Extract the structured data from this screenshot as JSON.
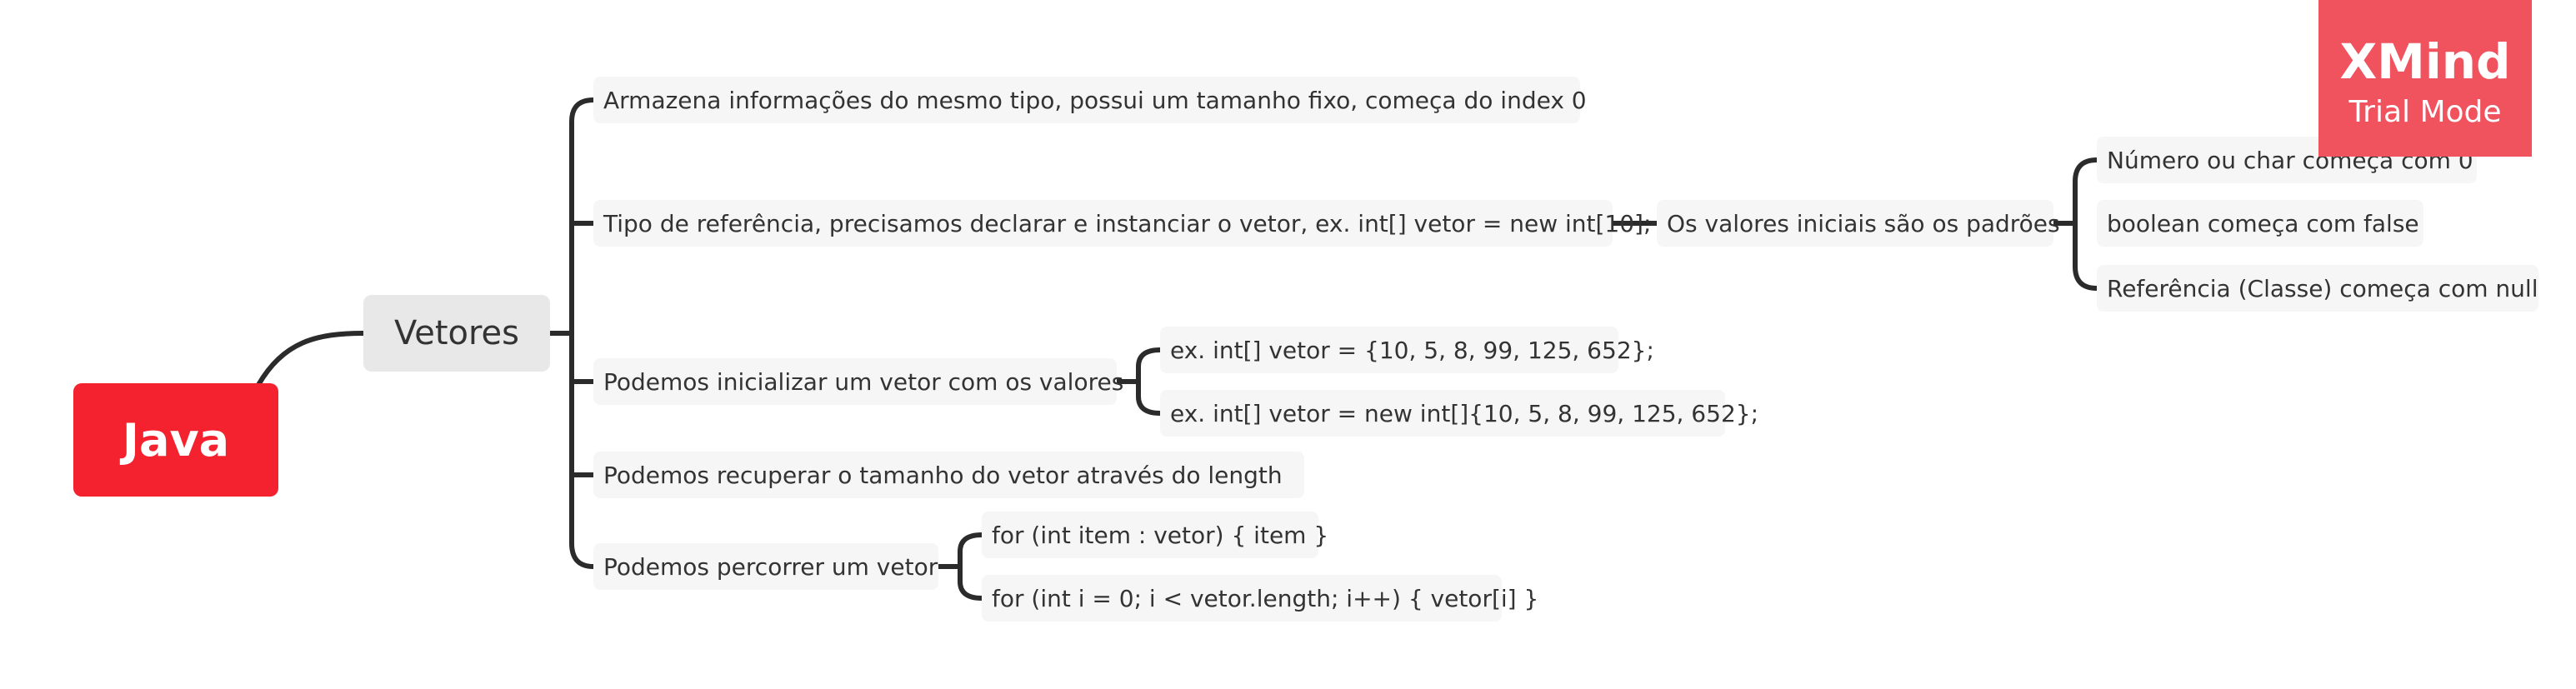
{
  "mindmap": {
    "root": "Java",
    "main": "Vetores",
    "topics": [
      "Armazena informações do mesmo tipo, possui um tamanho fixo, começa do index 0",
      "Tipo de referência, precisamos declarar e instanciar o vetor, ex. int[] vetor = new int[10];",
      "Podemos inicializar um vetor com os valores",
      "Podemos recuperar o tamanho do vetor através do length",
      "Podemos percorrer um vetor"
    ],
    "initial_values": "Os valores iniciais são os padrões",
    "defaults": [
      "Número ou char começa com 0",
      "boolean começa com false",
      "Referência (Classe) começa com null"
    ],
    "init_examples": [
      "ex. int[] vetor = {10, 5, 8, 99, 125, 652};",
      "ex. int[] vetor = new int[]{10, 5, 8, 99, 125, 652};"
    ],
    "loop_examples": [
      "for (int item : vetor) { item }",
      "for (int i = 0; i < vetor.length; i++) { vetor[i] }"
    ],
    "line_color": "#2b2b2b",
    "root_color": "#f4212f"
  },
  "watermark": {
    "title": "XMind",
    "subtitle": "Trial Mode",
    "color": "#f0525e"
  }
}
